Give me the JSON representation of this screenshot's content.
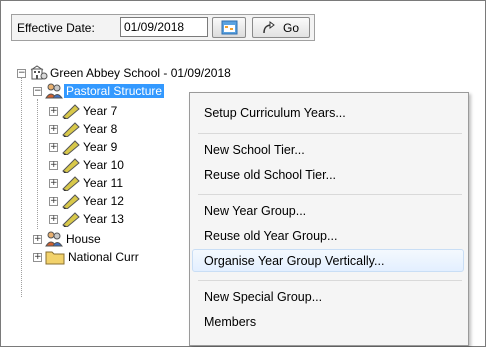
{
  "toolbar": {
    "effective_date_label": "Effective Date:",
    "effective_date_value": "01/09/2018",
    "go_label": "Go"
  },
  "tree": {
    "root": "Green Abbey School - 01/09/2018",
    "pastoral": "Pastoral Structure",
    "years": [
      "Year  7",
      "Year  8",
      "Year  9",
      "Year 10",
      "Year 11",
      "Year 12",
      "Year 13"
    ],
    "house": "House",
    "national": "National Curr"
  },
  "context_menu": {
    "items": [
      "Setup Curriculum Years...",
      "New School Tier...",
      "Reuse old School Tier...",
      "New Year Group...",
      "Reuse old Year Group...",
      "Organise Year Group Vertically...",
      "New Special Group...",
      "Members"
    ],
    "highlighted": "Organise Year Group Vertically..."
  },
  "colors": {
    "selection": "#3399ff",
    "folder": "#f2d26b",
    "ruler_pencil": "#d8c84a"
  }
}
